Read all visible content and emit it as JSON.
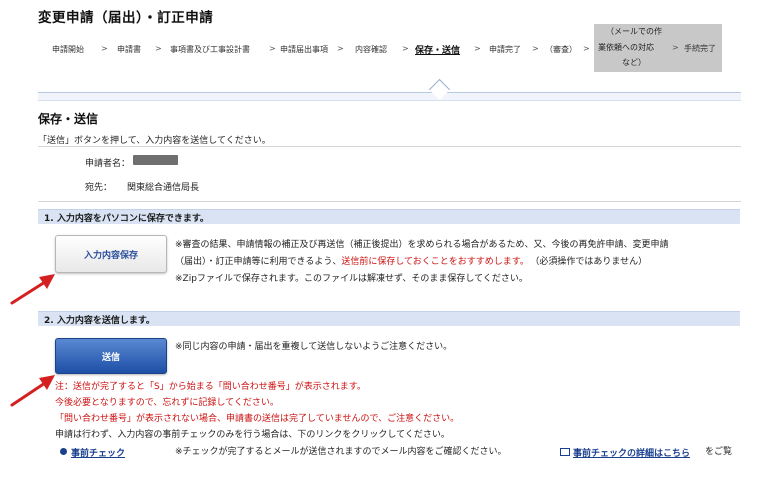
{
  "page_title": "変更申請（届出）・訂正申請",
  "steps": [
    "申請開始",
    "申請書",
    "事項書及び工事設計書",
    "申請届出事項",
    "内容確認",
    "保存・送信",
    "申請完了",
    "（審査）",
    "（メールでの作業依頼への対応など）",
    "手続完了"
  ],
  "step_sep": ">",
  "step_grey_lines": [
    "（メールでの作",
    "業依頼への対応",
    "など）"
  ],
  "section": {
    "title": "保存・送信",
    "description": "「送信」ボタンを押して、入力内容を送信してください。"
  },
  "info": {
    "applicant_label": "申請者名：",
    "to_label": "宛先：",
    "to_value": "関東総合通信局長"
  },
  "step1": {
    "heading": "1. 入力内容をパソコンに保存できます。",
    "button_label": "入力内容保存",
    "note_line1": "※審査の結果、申請情報の補正及び再送信（補正後提出）を求められる場合があるため、又、今後の再免許申請、変更申請",
    "note_line2a": "（届出）・訂正申請等に利用できるよう、",
    "note_line2b": "送信前に保存しておくことをおすすめします。",
    "note_line2c": "（必須操作ではありません）",
    "note_line3": "※Zipファイルで保存されます。このファイルは解凍せず、そのまま保存してください。"
  },
  "step2": {
    "heading": "2. 入力内容を送信します。",
    "button_label": "送信",
    "note": "※同じ内容の申請・届出を重複して送信しないようご注意ください。",
    "warn_line1": "注：送信が完了すると「S」から始まる「問い合わせ番号」が表示されます。",
    "warn_line2": "今後必要となりますので、忘れずに記録してください。",
    "warn_line3": "「問い合わせ番号」が表示されない場合、申請書の送信は完了していませんので、ご注意ください。",
    "precheck_info": "申請は行わず、入力内容の事前チェックのみを行う場合は、下のリンクをクリックしてください。",
    "precheck_link": "事前チェック",
    "precheck_note": "※チェックが完了するとメールが送信されますのでメール内容をご確認ください。",
    "detail_link": "事前チェックの詳細はこちら",
    "detail_suffix": "をご覧"
  },
  "colors": {
    "band": "#d9e3f4",
    "warning": "#cc1111",
    "link": "#1a3f8f",
    "primary_button": "#1d4fa6",
    "arrow": "#d42020"
  }
}
